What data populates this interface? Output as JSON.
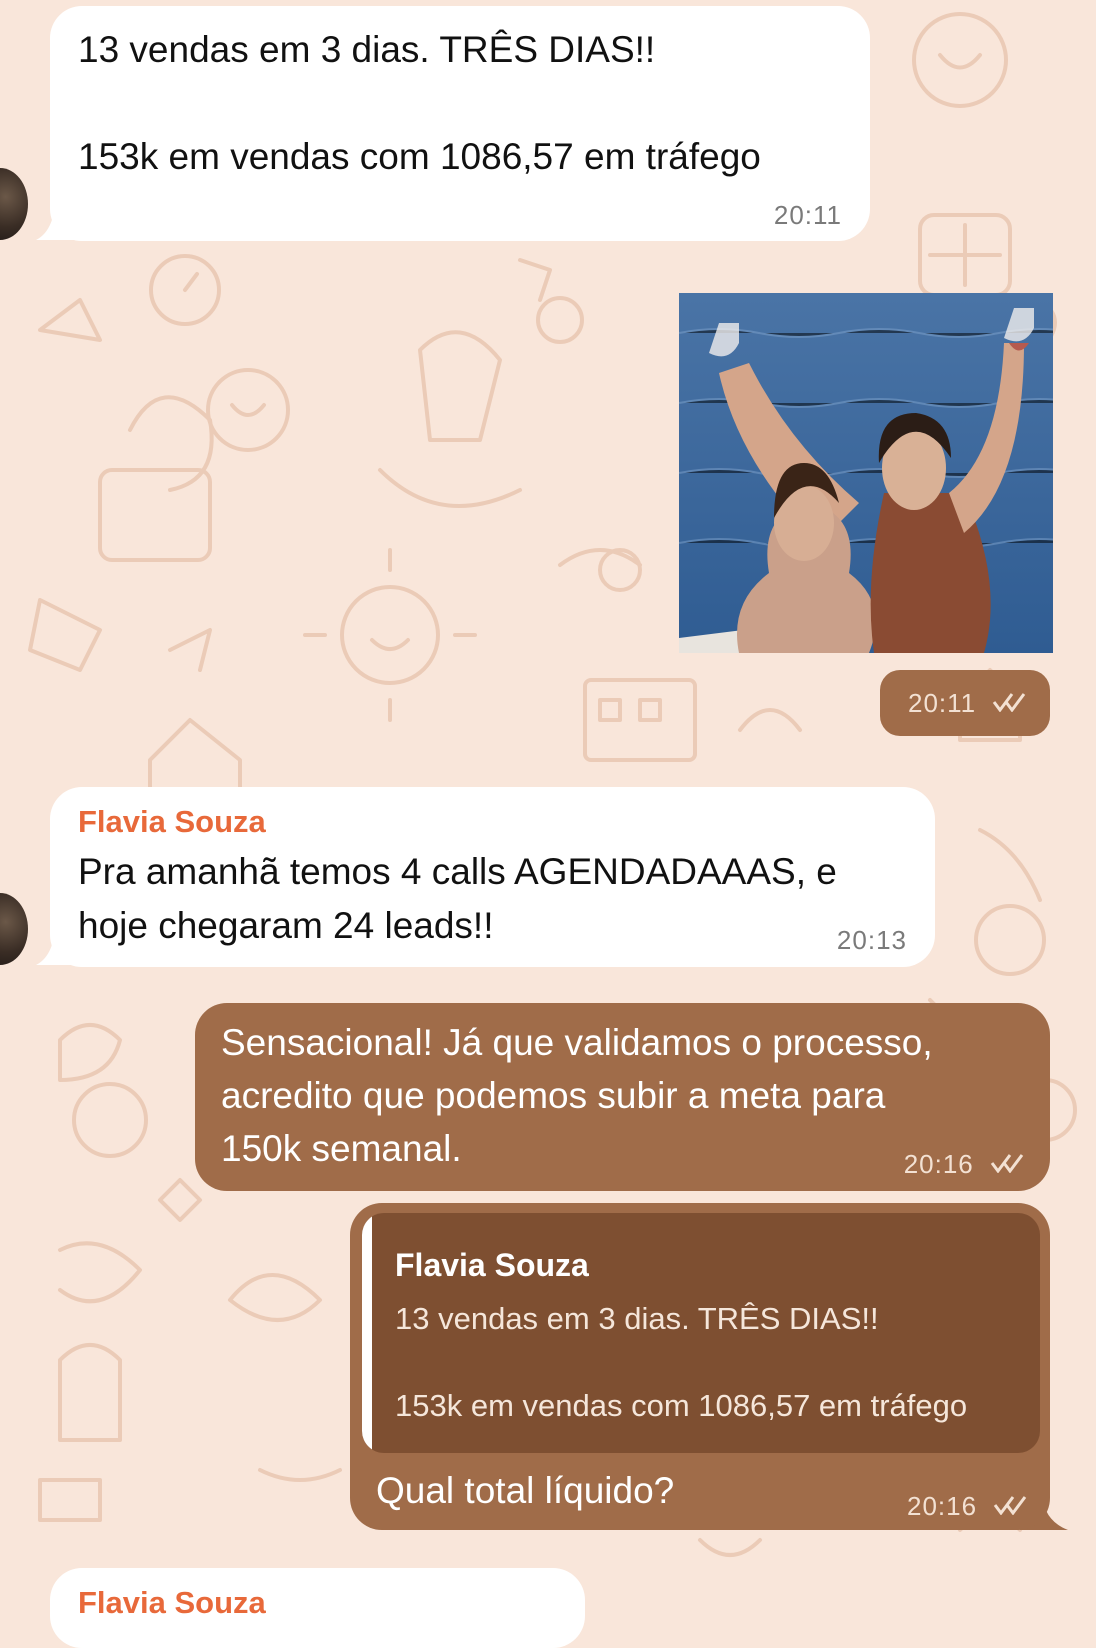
{
  "colors": {
    "wallpaper": "#f9e6da",
    "doodle": "#eacab6",
    "incoming_bubble": "#ffffff",
    "outgoing_bubble": "#a06c49",
    "quoted_block": "#7e4f31",
    "sender_name": "#e8693a"
  },
  "messages": [
    {
      "direction": "incoming",
      "line1": "13 vendas em 3 dias. TRÊS DIAS!!",
      "line2": "153k em vendas com 1086,57 em tráfego",
      "time": "20:11"
    },
    {
      "direction": "outgoing",
      "type": "image",
      "image_description": "two women on a boat raising wine glasses",
      "time": "20:11"
    },
    {
      "direction": "incoming",
      "sender": "Flavia Souza",
      "line1": "Pra amanhã temos 4 calls AGENDADAAAS, e",
      "line2": "hoje chegaram 24 leads!!",
      "time": "20:13"
    },
    {
      "direction": "outgoing",
      "line1": "Sensacional! Já que validamos o processo,",
      "line2": "acredito que podemos subir a meta para",
      "line3": "150k semanal.",
      "time": "20:16"
    },
    {
      "direction": "outgoing",
      "quote": {
        "sender": "Flavia Souza",
        "line1": "13 vendas em 3 dias. TRÊS DIAS!!",
        "line2": "153k em vendas com 1086,57 em tráfego"
      },
      "text": "Qual total líquido?",
      "time": "20:16"
    },
    {
      "direction": "incoming",
      "sender": "Flavia Souza"
    }
  ]
}
